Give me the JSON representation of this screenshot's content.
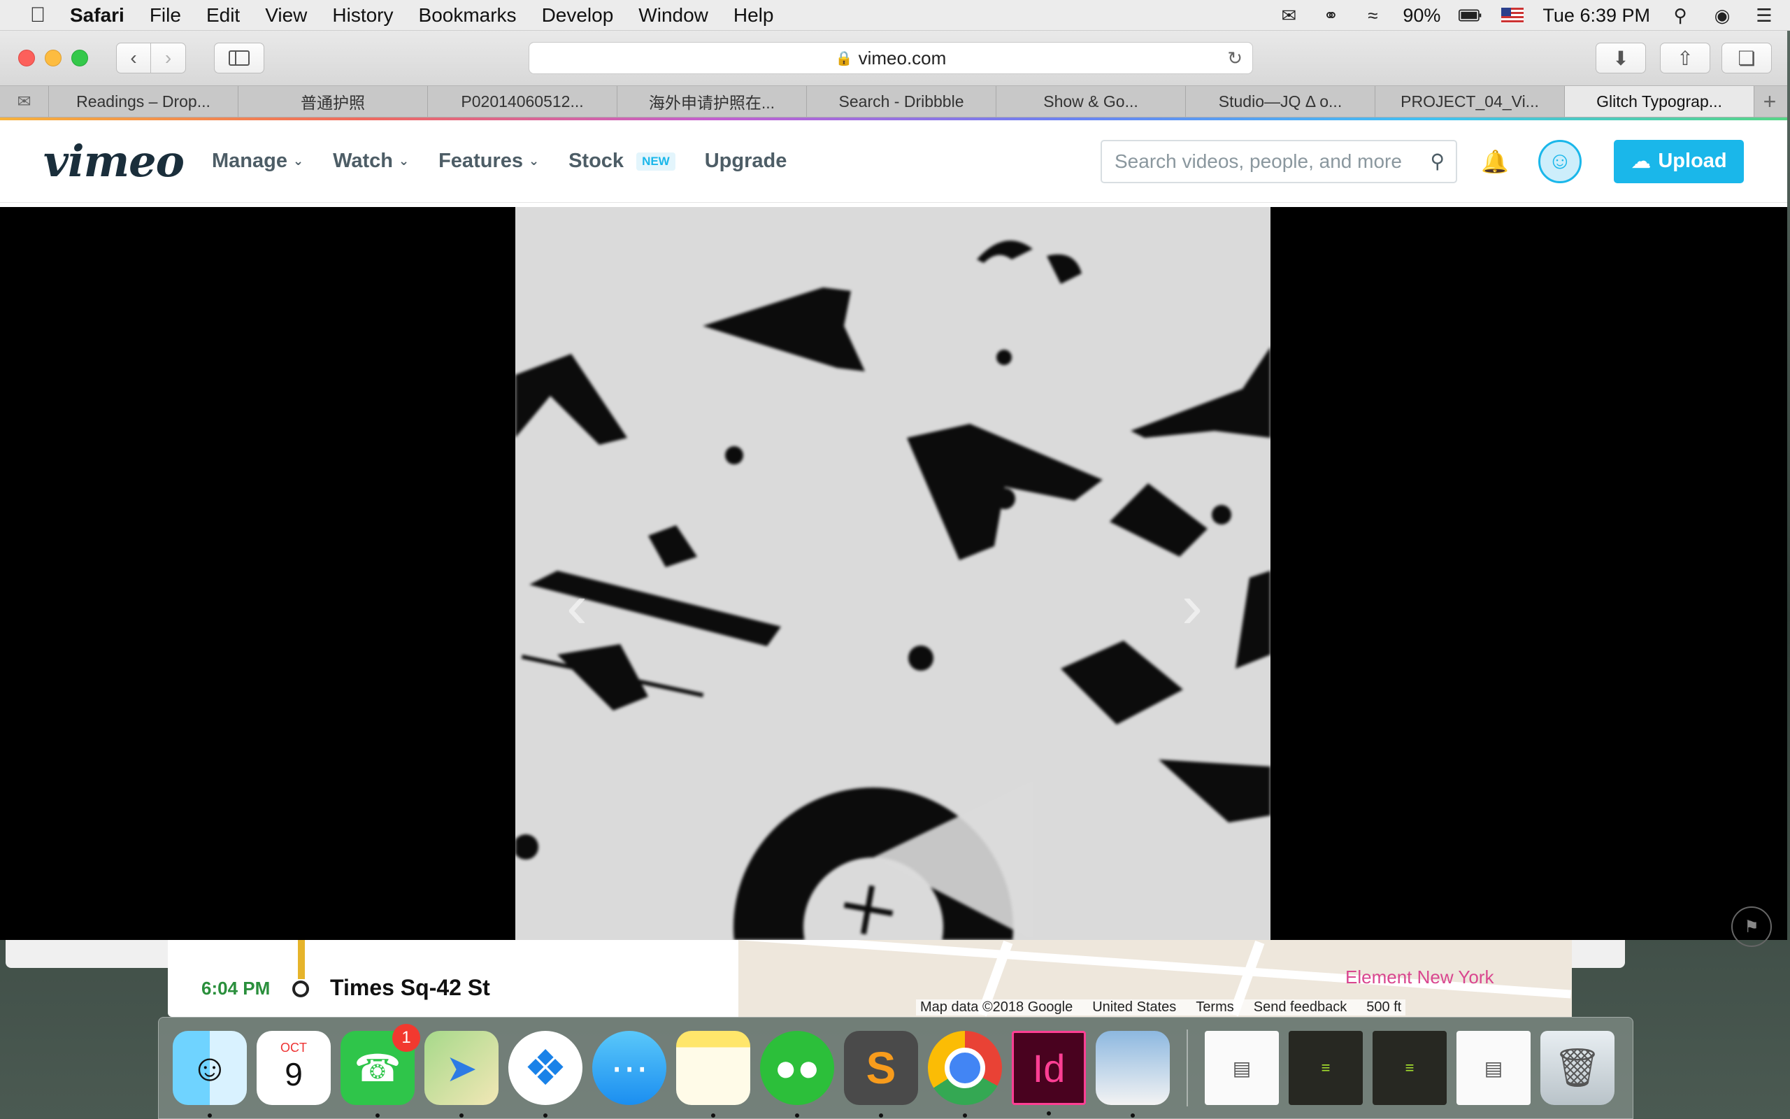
{
  "menubar": {
    "apple": "",
    "items": [
      "Safari",
      "File",
      "Edit",
      "View",
      "History",
      "Bookmarks",
      "Develop",
      "Window",
      "Help"
    ],
    "battery": "90%",
    "clock": "Tue 6:39 PM"
  },
  "browser": {
    "address": "vimeo.com",
    "tabs": [
      "Readings – Drop...",
      "普通护照",
      "P02014060512...",
      "海外申请护照在...",
      "Search - Dribbble",
      "Show & Go...",
      "Studio—JQ Δ o...",
      "PROJECT_04_Vi...",
      "Glitch Typograp..."
    ],
    "active_tab_index": 8
  },
  "vimeo": {
    "logo": "vimeo",
    "nav": {
      "manage": "Manage",
      "watch": "Watch",
      "features": "Features",
      "stock": "Stock",
      "stock_badge": "NEW",
      "upgrade": "Upgrade"
    },
    "search_placeholder": "Search videos, people, and more",
    "upload_label": "Upload",
    "accent_color": "#1ab7ea"
  },
  "maps": {
    "time": "6:04 PM",
    "station": "Times Sq-42 St",
    "map_data": "Map data ©2018 Google",
    "region": "United States",
    "terms": "Terms",
    "feedback": "Send feedback",
    "scale": "500 ft",
    "poi": "Element New York"
  },
  "dock": {
    "calendar_month": "OCT",
    "calendar_day": "9",
    "facetime_badge": "1",
    "sublime_glyph": "S",
    "indesign_label": "Id"
  }
}
